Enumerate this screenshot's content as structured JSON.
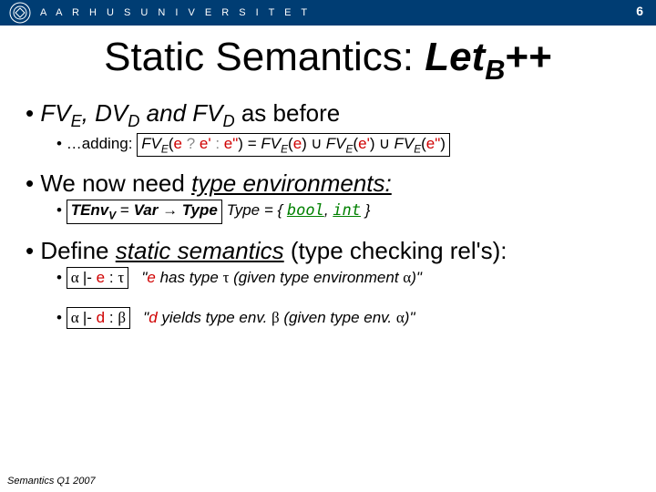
{
  "header": {
    "university": "A A R H U S   U N I V E R S I T E T",
    "page_number": "6"
  },
  "title": {
    "prefix": "Static Semantics: ",
    "let": "Let",
    "sub": "B",
    "suffix": "++"
  },
  "bullet1": {
    "text_a": "FV",
    "text_a_sub": "E",
    "text_b": ", DV",
    "text_b_sub": "D",
    "text_c": " and FV",
    "text_c_sub": "D",
    "text_d": " as before"
  },
  "bullet1_sub": {
    "lead": "…adding: ",
    "fv1": "FV",
    "fv1_sub": "E",
    "p1": "(",
    "e1": "e ",
    "q": "?",
    "e2": " e' ",
    "colon": ":",
    "e3": " e\"",
    "p2": ")",
    "eq": " = ",
    "fv2": "FV",
    "fv2_sub": "E",
    "p3": "(",
    "e4": "e",
    "p4": ")",
    "cup": " ∪ ",
    "fv3": "FV",
    "fv3_sub": "E",
    "p5": "(",
    "e5": "e'",
    "p6": ")",
    "fv4": "FV",
    "fv4_sub": "E",
    "p7": "(",
    "e6": "e\"",
    "p8": ")"
  },
  "bullet2": {
    "a": "We now need ",
    "b": "type environments:"
  },
  "bullet2_sub": {
    "tenv": "TEnv",
    "tenv_sub": "V",
    "eq": " = ",
    "var": "Var",
    "arrow": " → ",
    "type": "Type",
    "after": "  Type = { ",
    "bool": "bool",
    "comma": ", ",
    "int": "int",
    "close": " }"
  },
  "bullet3": {
    "a": "Define ",
    "b": "static semantics",
    "c": " (type checking rel's):"
  },
  "bullet3_sub1": {
    "alpha": "α ",
    "turn": "|- ",
    "e": "e",
    "colon": " : ",
    "tau": "τ",
    "quote_a": "\"",
    "quote_e": "e",
    "quote_b": " has type ",
    "quote_tau": "τ",
    "quote_c": " (given type environment ",
    "quote_alpha": "α",
    "quote_d": ")\""
  },
  "bullet3_sub2": {
    "alpha": "α ",
    "turn": "|- ",
    "d": "d",
    "colon": " : ",
    "beta": "β",
    "quote_a": "\"",
    "quote_d": "d",
    "quote_b": " yields type env. ",
    "quote_beta": "β",
    "quote_c": " (given type env. ",
    "quote_alpha": "α",
    "quote_e": ")\""
  },
  "footer": "Semantics Q1 2007"
}
